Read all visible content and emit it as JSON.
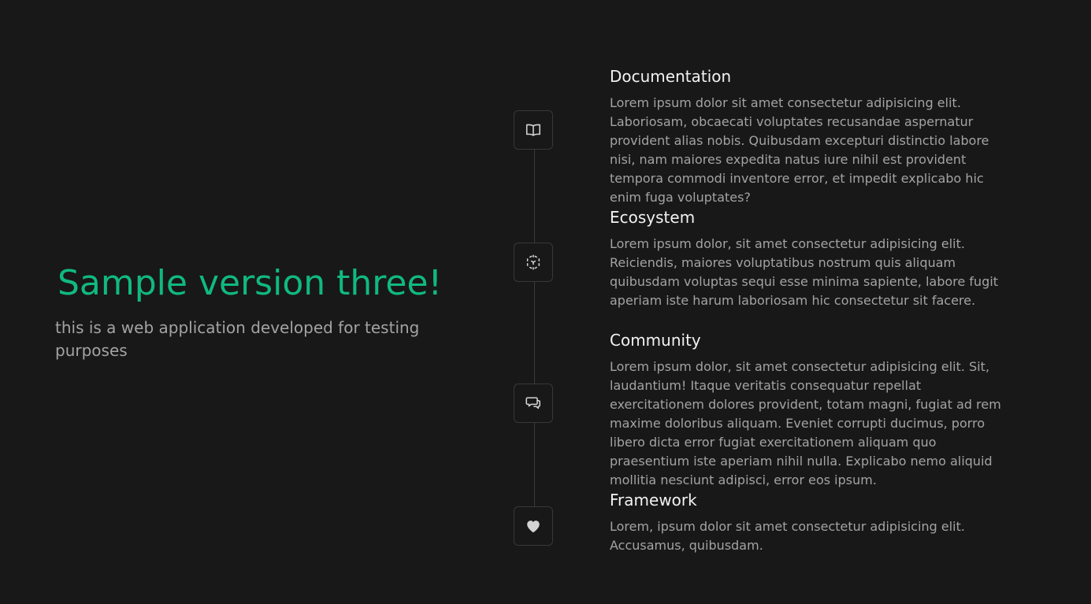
{
  "hero": {
    "title": "Sample version three!",
    "subtitle": "this is a web application developed for testing purposes"
  },
  "colors": {
    "accent": "#10b981",
    "background": "#181818",
    "muted_text": "#a3a3a3"
  },
  "features": [
    {
      "icon": "book-icon",
      "title": "Documentation",
      "text": "Lorem ipsum dolor sit amet consectetur adipisicing elit. Laboriosam, obcaecati voluptates recusandae aspernatur provident alias nobis. Quibusdam excepturi distinctio labore nisi, nam maiores expedita natus iure nihil est provident tempora commodi inventore error, et impedit explicabo hic enim fuga voluptates?"
    },
    {
      "icon": "cube-icon",
      "title": "Ecosystem",
      "text": "Lorem ipsum dolor, sit amet consectetur adipisicing elit. Reiciendis, maiores voluptatibus nostrum quis aliquam quibusdam voluptas sequi esse minima sapiente, labore fugit aperiam iste harum laboriosam hic consectetur sit facere."
    },
    {
      "icon": "chat-icon",
      "title": "Community",
      "text": "Lorem ipsum dolor, sit amet consectetur adipisicing elit. Sit, laudantium! Itaque veritatis consequatur repellat exercitationem dolores provident, totam magni, fugiat ad rem maxime doloribus aliquam. Eveniet corrupti ducimus, porro libero dicta error fugiat exercitationem aliquam quo praesentium iste aperiam nihil nulla. Explicabo nemo aliquid mollitia nesciunt adipisci, error eos ipsum."
    },
    {
      "icon": "heart-icon",
      "title": "Framework",
      "text": "Lorem, ipsum dolor sit amet consectetur adipisicing elit. Accusamus, quibusdam."
    }
  ]
}
